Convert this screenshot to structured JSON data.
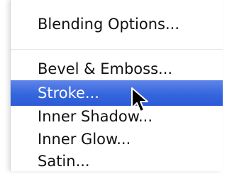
{
  "menu": {
    "items": [
      {
        "label": "Blending Options...",
        "selected": false
      },
      {
        "label": "Bevel & Emboss...",
        "selected": false
      },
      {
        "label": "Stroke...",
        "selected": true
      },
      {
        "label": "Inner Shadow...",
        "selected": false
      },
      {
        "label": "Inner Glow...",
        "selected": false
      },
      {
        "label": "Satin...",
        "selected": false
      }
    ]
  },
  "colors": {
    "selection": "#3566dd",
    "selected_text": "#ffffff",
    "text": "#111111"
  },
  "cursor": {
    "icon": "arrow-pointer-icon"
  }
}
